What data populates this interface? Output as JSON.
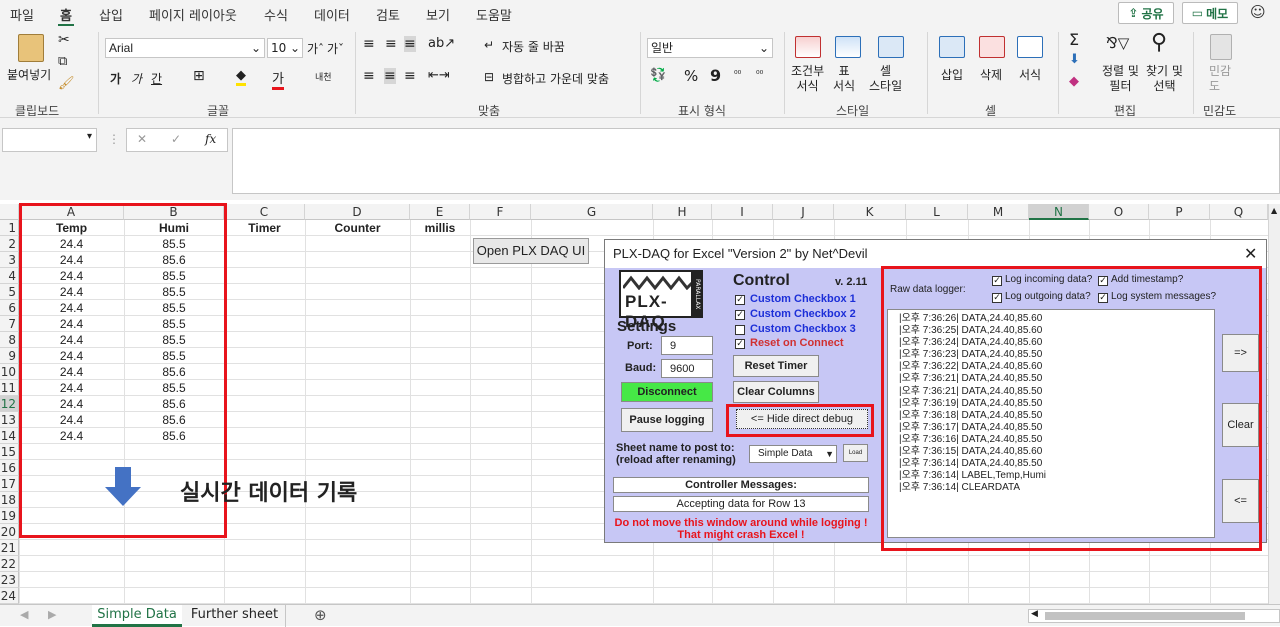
{
  "menu": {
    "tabs": [
      "파일",
      "홈",
      "삽입",
      "페이지 레이아웃",
      "수식",
      "데이터",
      "검토",
      "보기",
      "도움말"
    ],
    "share": "공유",
    "memo": "메모"
  },
  "ribbon": {
    "clipboard": {
      "paste": "붙여넣기",
      "label": "클립보드"
    },
    "font": {
      "name": "Arial",
      "size": "10",
      "label": "글꼴",
      "bold": "가",
      "italic": "가",
      "underline": "간"
    },
    "align": {
      "wrap": "자동 줄 바꿈",
      "merge": "병합하고 가운데 맞춤",
      "label": "맞춤"
    },
    "number": {
      "format": "일반",
      "percent": "%",
      "comma": "9",
      "label": "표시 형식"
    },
    "styles": {
      "cond": "조건부\n서식",
      "table": "표\n서식",
      "cell": "셀\n스타일",
      "label": "스타일"
    },
    "cells": {
      "insert": "삽입",
      "delete": "삭제",
      "format": "서식",
      "label": "셀"
    },
    "edit": {
      "sort": "정렬 및\n필터",
      "find": "찾기 및\n선택",
      "label": "편집"
    },
    "sensitivity": {
      "name": "민감\n도",
      "label": "민감도"
    }
  },
  "formula_bar": {
    "fx": "fx"
  },
  "columns": [
    "A",
    "B",
    "C",
    "D",
    "E",
    "F",
    "G",
    "H",
    "I",
    "J",
    "K",
    "L",
    "M",
    "N",
    "O",
    "P",
    "Q"
  ],
  "rows": [
    "1",
    "2",
    "3",
    "4",
    "5",
    "6",
    "7",
    "8",
    "9",
    "10",
    "11",
    "12",
    "13",
    "14",
    "15",
    "16",
    "17",
    "18",
    "19",
    "20",
    "21",
    "22",
    "23",
    "24"
  ],
  "headers": {
    "a": "Temp",
    "b": "Humi",
    "c": "Timer",
    "d": "Counter",
    "e": "millis"
  },
  "temp": [
    "24.4",
    "24.4",
    "24.4",
    "24.4",
    "24.4",
    "24.4",
    "24.4",
    "24.4",
    "24.4",
    "24.4",
    "24.4",
    "24.4",
    "24.4"
  ],
  "humi": [
    "85.5",
    "85.6",
    "85.5",
    "85.5",
    "85.5",
    "85.5",
    "85.5",
    "85.5",
    "85.6",
    "85.5",
    "85.6",
    "85.6",
    "85.6"
  ],
  "open_btn": "Open PLX DAQ UI",
  "annotation": "실시간 데이터 기록",
  "sheets": [
    "Simple Data",
    "Further sheet"
  ],
  "dialog": {
    "title": "PLX-DAQ for Excel \"Version 2\" by Net^Devil",
    "logo": "PLX-DAQ",
    "logo_side": "PARALLAX",
    "control": "Control",
    "version": "v. 2.11",
    "checkboxes": [
      {
        "label": "Custom Checkbox 1",
        "checked": true
      },
      {
        "label": "Custom Checkbox 2",
        "checked": true
      },
      {
        "label": "Custom Checkbox 3",
        "checked": false
      },
      {
        "label": "Reset on Connect",
        "checked": true
      }
    ],
    "settings": "Settings",
    "port_label": "Port:",
    "port": "9",
    "baud_label": "Baud:",
    "baud": "9600",
    "disconnect": "Disconnect",
    "pause": "Pause logging",
    "reset_timer": "Reset Timer",
    "clear_columns": "Clear Columns",
    "hide_debug": "<= Hide direct debug",
    "sheet_label": "Sheet name to post to:\n(reload after renaming)",
    "sheet_value": "Simple Data",
    "load": "Load",
    "controller": "Controller Messages:",
    "status": "Accepting data for Row 13",
    "warning": "Do not move this window around while logging !\nThat might crash Excel !",
    "raw_logger": "Raw data logger:",
    "log_opts": [
      {
        "label": "Log incoming data?",
        "checked": true
      },
      {
        "label": "Add timestamp?",
        "checked": true
      },
      {
        "label": "Log outgoing data?",
        "checked": true
      },
      {
        "label": "Log system messages?",
        "checked": true
      }
    ],
    "log_lines": [
      "|오후 7:36:26| DATA,24.40,85.60",
      "|오후 7:36:25| DATA,24.40,85.60",
      "|오후 7:36:24| DATA,24.40,85.60",
      "|오후 7:36:23| DATA,24.40,85.50",
      "|오후 7:36:22| DATA,24.40,85.60",
      "|오후 7:36:21| DATA,24.40,85.50",
      "|오후 7:36:21| DATA,24.40,85.50",
      "|오후 7:36:19| DATA,24.40,85.50",
      "|오후 7:36:18| DATA,24.40,85.50",
      "|오후 7:36:17| DATA,24.40,85.50",
      "|오후 7:36:16| DATA,24.40,85.50",
      "|오후 7:36:15| DATA,24.40,85.60",
      "|오후 7:36:14| DATA,24.40,85.50",
      "|오후 7:36:14| LABEL,Temp,Humi",
      "|오후 7:36:14| CLEARDATA"
    ],
    "btn_right": "=>",
    "btn_clear": "Clear",
    "btn_left": "<="
  }
}
